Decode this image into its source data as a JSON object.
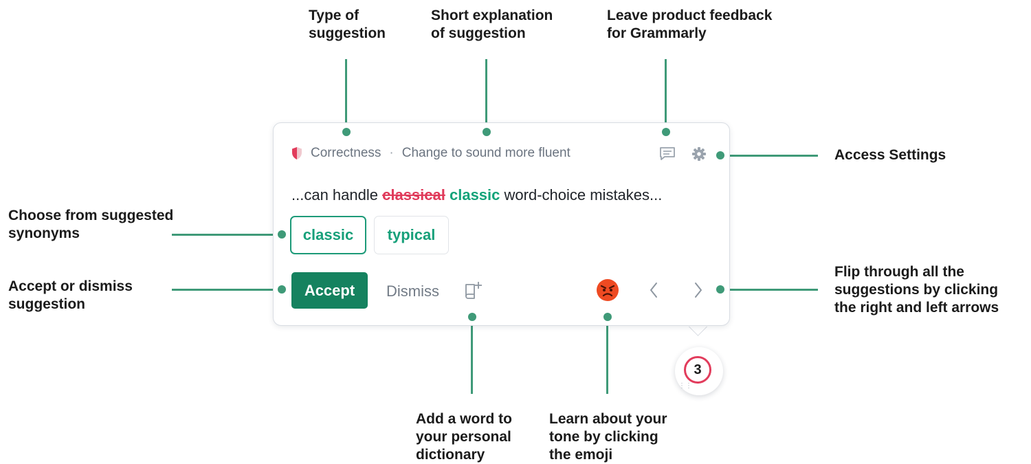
{
  "card": {
    "category": "Correctness",
    "separator": "·",
    "explanation": "Change to sound more fluent",
    "sentence_prefix": "...can handle",
    "removed_word": "classical",
    "replacement_word": "classic",
    "sentence_suffix": "word-choice mistakes...",
    "synonyms": [
      "classic",
      "typical"
    ],
    "accept_label": "Accept",
    "dismiss_label": "Dismiss",
    "suggestion_count": "3"
  },
  "annotations": {
    "type_of_suggestion": "Type of\nsuggestion",
    "short_explanation": "Short explanation\nof suggestion",
    "product_feedback": "Leave product feedback\nfor Grammarly",
    "access_settings": "Access Settings",
    "choose_synonyms": "Choose from suggested\nsynonyms",
    "accept_dismiss": "Accept or dismiss\nsuggestion",
    "flip_suggestions": "Flip through all the\nsuggestions by clicking\nthe right and left arrows",
    "personal_dictionary": "Add a word to\nyour personal\ndictionary",
    "learn_tone": "Learn about your\ntone by clicking\nthe emoji"
  },
  "colors": {
    "accent": "#3f9a78",
    "accept_button": "#15825f",
    "suggestion_green": "#13a37a",
    "error_red": "#e03a5a"
  },
  "icons": [
    "shield-icon",
    "feedback-icon",
    "gear-icon",
    "add-to-dictionary-icon",
    "angry-emoji-icon",
    "chevron-left-icon",
    "chevron-right-icon",
    "grip-icon"
  ]
}
